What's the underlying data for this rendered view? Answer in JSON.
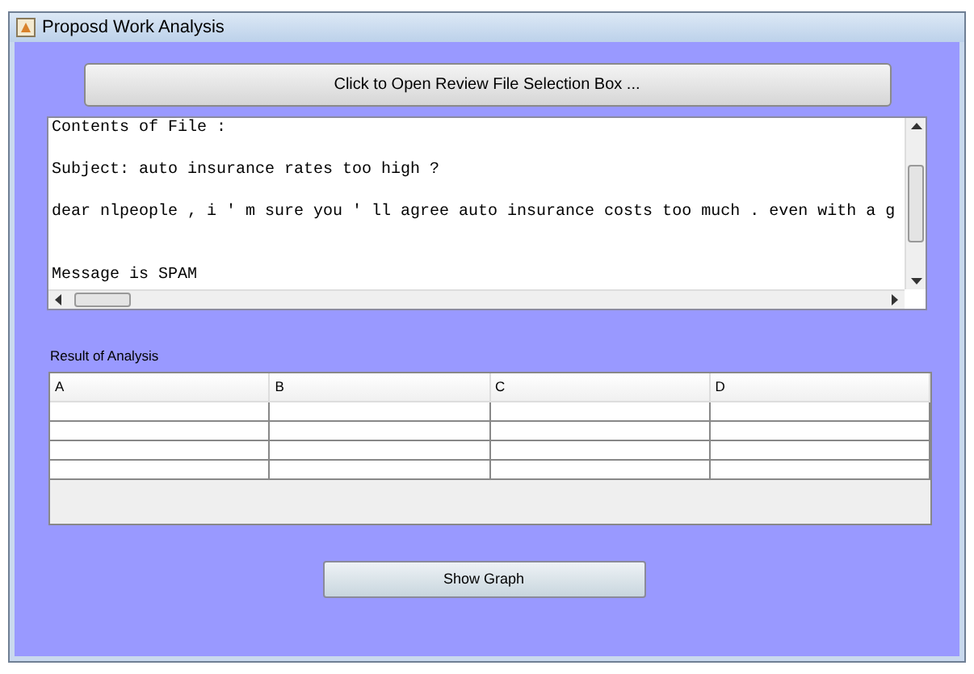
{
  "window": {
    "title": "Proposd Work Analysis"
  },
  "open_button": {
    "label": "Click to Open Review File Selection Box ..."
  },
  "text_area": {
    "lines": [
      {
        "kind": "line",
        "text": "Contents of File :"
      },
      {
        "kind": "blank"
      },
      {
        "kind": "line",
        "text": "Subject: auto insurance rates too high ?"
      },
      {
        "kind": "blank"
      },
      {
        "kind": "line",
        "text": "dear nlpeople , i ' m sure you ' ll agree auto insurance costs too much . even with a g"
      },
      {
        "kind": "blank"
      },
      {
        "kind": "blank"
      },
      {
        "kind": "line",
        "text": "Message is SPAM"
      }
    ]
  },
  "result": {
    "title": "Result of Analysis",
    "columns": [
      "A",
      "B",
      "C",
      "D"
    ]
  },
  "graph_button": {
    "label": "Show Graph"
  }
}
